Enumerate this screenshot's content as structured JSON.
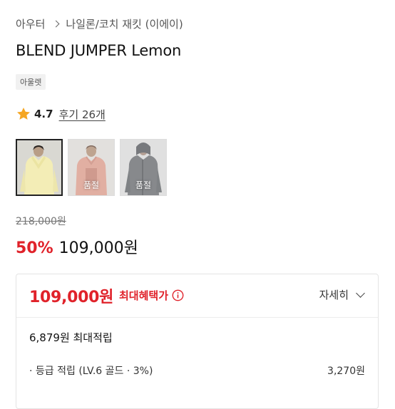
{
  "breadcrumb": {
    "category": "아우터",
    "subcategory": "나일론/코치 재킷 (이에이)"
  },
  "product": {
    "name": "BLEND JUMPER Lemon",
    "tag": "아울렛"
  },
  "rating": {
    "score": "4.7",
    "reviews": "후기 26개"
  },
  "thumbnails": [
    {
      "status": ""
    },
    {
      "status": "품절"
    },
    {
      "status": "품절"
    }
  ],
  "price": {
    "original": "218,000원",
    "discount": "50%",
    "sale": "109,000원"
  },
  "benefit_panel": {
    "max_benefit_price": "109,000원",
    "max_benefit_label": "최대혜택가",
    "detail_label": "자세히",
    "max_points": "6,879원 최대적립",
    "grade_points_label": "· 등급 적립 (LV.6 골드 · 3%)",
    "grade_points_value": "3,270원"
  },
  "colors": {
    "accent_red": "#e0222a",
    "star": "#f5a623"
  }
}
